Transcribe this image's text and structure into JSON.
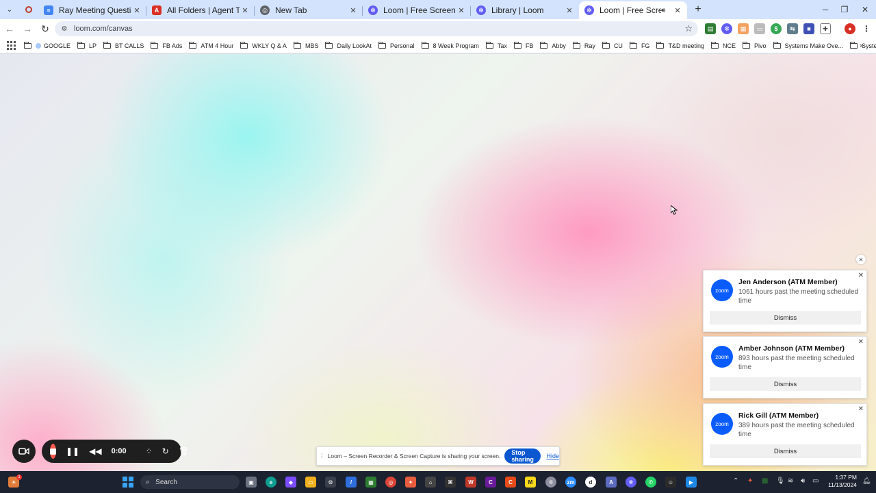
{
  "browser": {
    "tabs": [
      {
        "title": "Ray Meeting Questions - Goog",
        "icon": "google-docs-icon",
        "color": "#4285f4"
      },
      {
        "title": "All Folders | Agent Tech Master",
        "icon": "agent-tech-icon",
        "color": "#d93025"
      },
      {
        "title": "New Tab",
        "icon": "chrome-icon",
        "color": "#5f6368"
      },
      {
        "title": "Loom | Free Screen & Video Re",
        "icon": "loom-icon",
        "color": "#625df5"
      },
      {
        "title": "Library | Loom",
        "icon": "loom-icon",
        "color": "#625df5"
      },
      {
        "title": "Loom | Free Screen & Video",
        "icon": "loom-icon",
        "color": "#625df5"
      }
    ],
    "url": "loom.com/canvas",
    "bookmarks": [
      "GOOGLE",
      "LP",
      "BT CALLS",
      "FB Ads",
      "ATM 4 Hour",
      "WKLY Q & A",
      "MBS",
      "Daily LookAt",
      "Personal",
      "8 Week Program",
      "Tax",
      "FB",
      "Abby",
      "Ray",
      "CU",
      "FG",
      "T&D meeting",
      "NCE",
      "Pivo",
      "Systems Make Ove...",
      "Systeme"
    ]
  },
  "loom": {
    "timer": "0:00",
    "stop_color": "#ff5a4e"
  },
  "share_bar": {
    "message": "Loom – Screen Recorder & Screen Capture is sharing your screen.",
    "stop_label": "Stop sharing",
    "hide_label": "Hide"
  },
  "notifications": [
    {
      "logo": "zoom",
      "title": "Jen Anderson (ATM Member)",
      "body": "1061 hours past the meeting scheduled time",
      "button": "Dismiss"
    },
    {
      "logo": "zoom",
      "title": "Amber  Johnson (ATM Member)",
      "body": "893 hours past the meeting scheduled time",
      "button": "Dismiss"
    },
    {
      "logo": "zoom",
      "title": "Rick Gill (ATM Member)",
      "body": "389 hours past the meeting scheduled time",
      "button": "Dismiss"
    }
  ],
  "taskbar": {
    "search_placeholder": "Search",
    "time": "1:37 PM",
    "date": "11/13/2024",
    "notification_count": "1"
  }
}
